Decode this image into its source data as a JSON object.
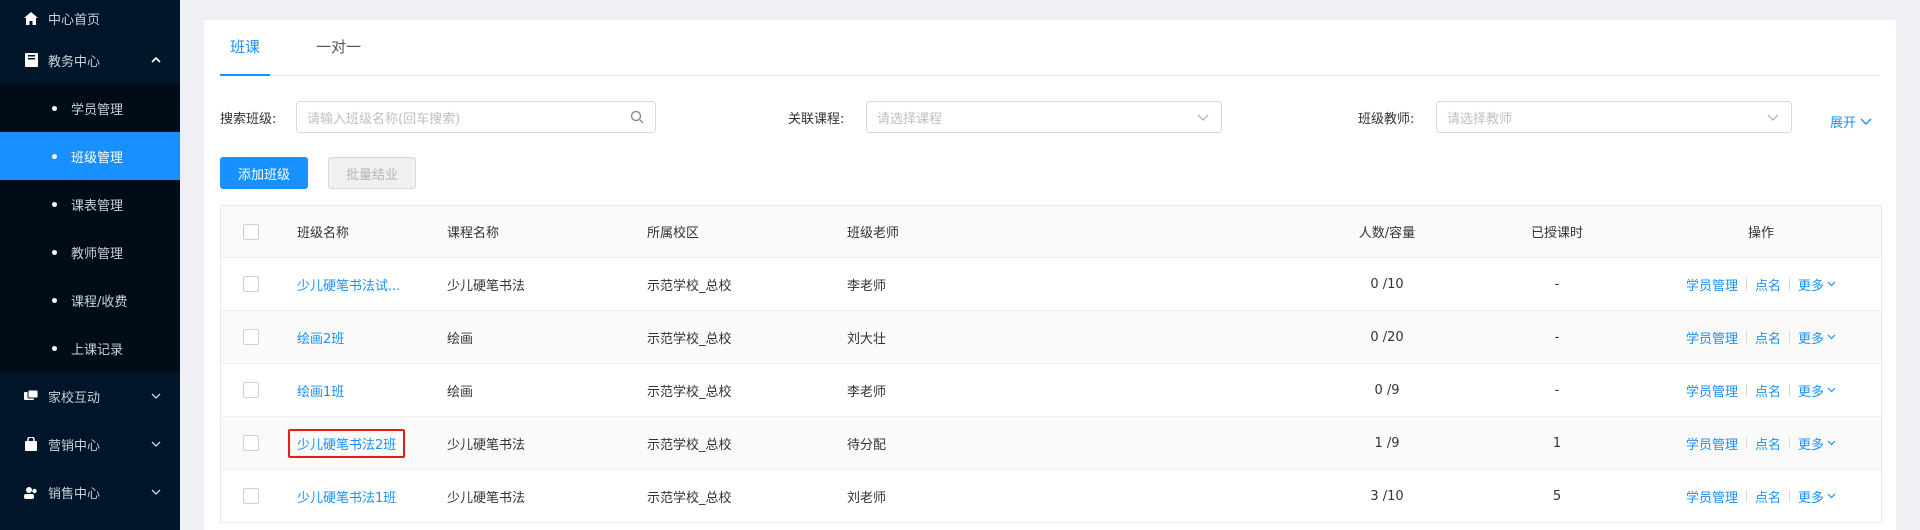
{
  "sidebar": {
    "home": "中心首页",
    "edu": "教务中心",
    "edu_items": [
      "学员管理",
      "班级管理",
      "课表管理",
      "教师管理",
      "课程/收费",
      "上课记录"
    ],
    "home_school": "家校互动",
    "marketing": "营销中心",
    "sales": "销售中心"
  },
  "tabs": [
    "班课",
    "一对一"
  ],
  "filters": {
    "search_label": "搜索班级:",
    "search_placeholder": "请输入班级名称(回车搜索)",
    "course_label": "关联课程:",
    "course_placeholder": "请选择课程",
    "teacher_label": "班级教师:",
    "teacher_placeholder": "请选择教师",
    "expand": "展开"
  },
  "actions": {
    "add": "添加班级",
    "batch": "批量结业"
  },
  "table": {
    "headers": [
      "班级名称",
      "课程名称",
      "所属校区",
      "班级老师",
      "人数/容量",
      "已授课时",
      "操作"
    ],
    "rows": [
      {
        "name": "少儿硬笔书法试...",
        "course": "少儿硬笔书法",
        "campus": "示范学校_总校",
        "teacher": "李老师",
        "count": "0 /10",
        "hours": "-"
      },
      {
        "name": "绘画2班",
        "course": "绘画",
        "campus": "示范学校_总校",
        "teacher": "刘大壮",
        "count": "0 /20",
        "hours": "-"
      },
      {
        "name": "绘画1班",
        "course": "绘画",
        "campus": "示范学校_总校",
        "teacher": "李老师",
        "count": "0 /9",
        "hours": "-"
      },
      {
        "name": "少儿硬笔书法2班",
        "course": "少儿硬笔书法",
        "campus": "示范学校_总校",
        "teacher": "待分配",
        "count": "1 /9",
        "hours": "1"
      },
      {
        "name": "少儿硬笔书法1班",
        "course": "少儿硬笔书法",
        "campus": "示范学校_总校",
        "teacher": "刘老师",
        "count": "3 /10",
        "hours": "5"
      }
    ],
    "op_student": "学员管理",
    "op_rollcall": "点名",
    "op_more": "更多"
  },
  "colors": {
    "accent": "#1890ff",
    "sidebar_bg": "#001529",
    "highlight": "#e41c1c"
  },
  "icons": [
    "home-icon",
    "book-icon",
    "chat-icon",
    "bag-icon",
    "people-icon",
    "search-icon",
    "chevron-down-icon",
    "chevron-up-icon"
  ]
}
